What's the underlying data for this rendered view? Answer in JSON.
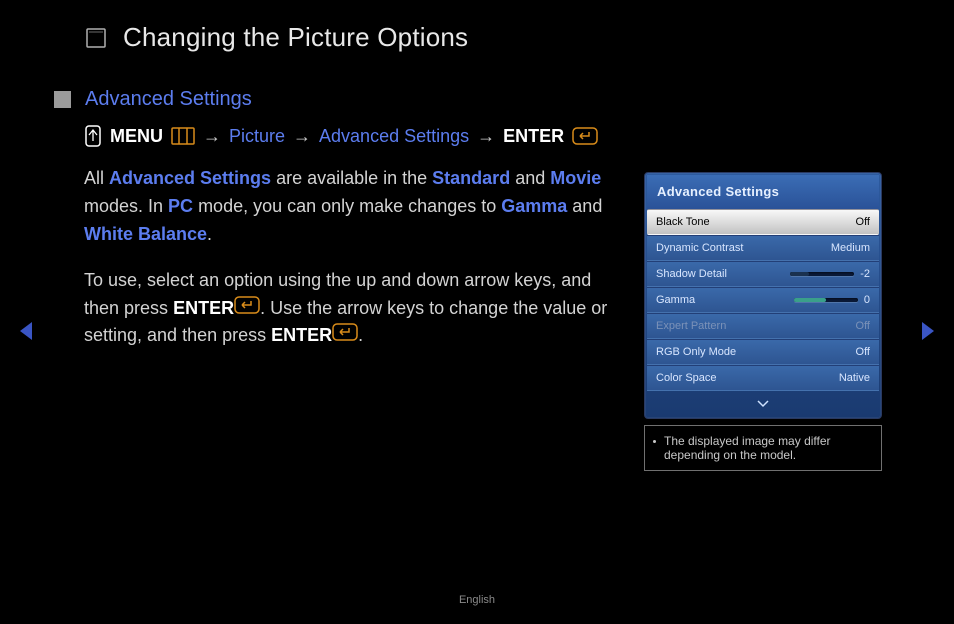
{
  "page": {
    "title": "Changing the Picture Options",
    "section_title": "Advanced Settings",
    "language": "English"
  },
  "breadcrumb": {
    "menu": "MENU",
    "item1": "Picture",
    "item2": "Advanced Settings",
    "enter": "ENTER",
    "arrow": "→"
  },
  "body": {
    "p1a": "All ",
    "p1_link1": "Advanced Settings",
    "p1b": " are available in the ",
    "p1_link2": "Standard",
    "p1c": " and ",
    "p1_link3": "Movie",
    "p1d": " modes. In ",
    "p1_link4": "PC",
    "p1e": " mode, you can only make changes to ",
    "p1_link5": "Gamma",
    "p1f": " and ",
    "p1_link6": "White Balance",
    "p1g": ".",
    "p2a": "To use, select an option using the up and down arrow keys, and then press ",
    "p2_enter1": "ENTER",
    "p2b": ". Use the arrow keys to change the value or setting, and then press ",
    "p2_enter2": "ENTER",
    "p2c": "."
  },
  "panel": {
    "title": "Advanced Settings",
    "rows": [
      {
        "label": "Black Tone",
        "value": "Off",
        "selected": true
      },
      {
        "label": "Dynamic Contrast",
        "value": "Medium"
      },
      {
        "label": "Shadow Detail",
        "value": "-2",
        "slider": true,
        "fill_pct": 30,
        "fill_color": "#1a314f"
      },
      {
        "label": "Gamma",
        "value": "0",
        "slider": true,
        "fill_pct": 50,
        "fill_color": "#3aa08a"
      },
      {
        "label": "Expert Pattern",
        "value": "Off",
        "disabled": true
      },
      {
        "label": "RGB Only Mode",
        "value": "Off"
      },
      {
        "label": "Color Space",
        "value": "Native"
      }
    ]
  },
  "note": {
    "text": "The displayed image may differ depending on the model."
  }
}
